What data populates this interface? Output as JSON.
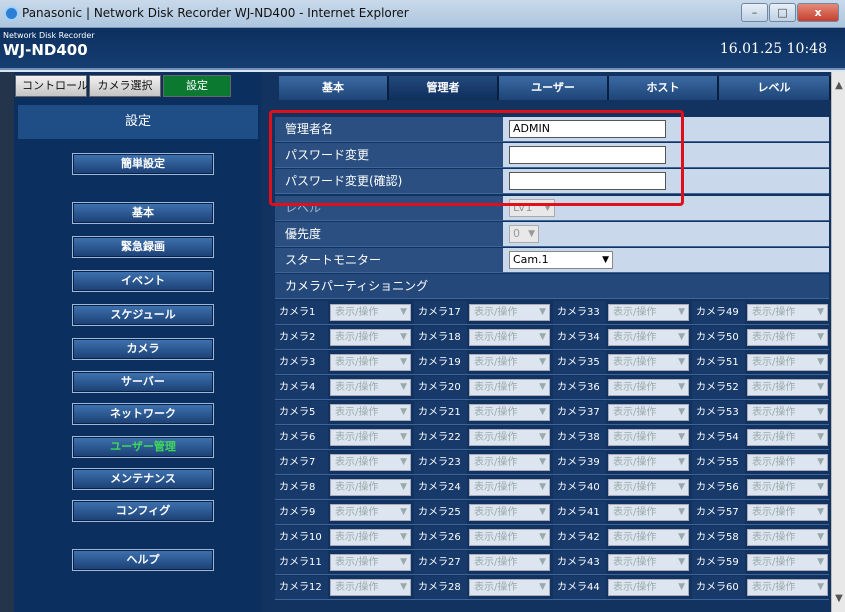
{
  "window": {
    "title": "Panasonic | Network Disk Recorder WJ-ND400 - Internet Explorer",
    "minimize": "–",
    "maximize": "□",
    "close": "x"
  },
  "header": {
    "product": "Network Disk Recorder",
    "model": "WJ-ND400",
    "datetime": "16.01.25  10:48"
  },
  "top_tabs": [
    {
      "label": "コントロール"
    },
    {
      "label": "カメラ選択"
    },
    {
      "label": "設定"
    }
  ],
  "sidebar": {
    "title": "設定",
    "items": [
      {
        "label": "簡単設定"
      },
      {
        "label": "基本"
      },
      {
        "label": "緊急録画"
      },
      {
        "label": "イベント"
      },
      {
        "label": "スケジュール"
      },
      {
        "label": "カメラ"
      },
      {
        "label": "サーバー"
      },
      {
        "label": "ネットワーク"
      },
      {
        "label": "ユーザー管理"
      },
      {
        "label": "メンテナンス"
      },
      {
        "label": "コンフィグ"
      },
      {
        "label": "ヘルプ"
      }
    ]
  },
  "tabs": [
    {
      "label": "基本"
    },
    {
      "label": "管理者"
    },
    {
      "label": "ユーザー"
    },
    {
      "label": "ホスト"
    },
    {
      "label": "レベル"
    }
  ],
  "form": {
    "admin_name_label": "管理者名",
    "admin_name_value": "ADMIN",
    "password_label": "パスワード変更",
    "password_value": "",
    "password_confirm_label": "パスワード変更(確認)",
    "password_confirm_value": "",
    "level_label": "レベル",
    "level_value": "LV1",
    "priority_label": "優先度",
    "priority_value": "0",
    "start_monitor_label": "スタートモニター",
    "start_monitor_value": "Cam.1",
    "partition_label": "カメラパーティショニング"
  },
  "camera_option": "表示/操作",
  "cameras": [
    [
      "カメラ1",
      "カメラ17",
      "カメラ33",
      "カメラ49"
    ],
    [
      "カメラ2",
      "カメラ18",
      "カメラ34",
      "カメラ50"
    ],
    [
      "カメラ3",
      "カメラ19",
      "カメラ35",
      "カメラ51"
    ],
    [
      "カメラ4",
      "カメラ20",
      "カメラ36",
      "カメラ52"
    ],
    [
      "カメラ5",
      "カメラ21",
      "カメラ37",
      "カメラ53"
    ],
    [
      "カメラ6",
      "カメラ22",
      "カメラ38",
      "カメラ54"
    ],
    [
      "カメラ7",
      "カメラ23",
      "カメラ39",
      "カメラ55"
    ],
    [
      "カメラ8",
      "カメラ24",
      "カメラ40",
      "カメラ56"
    ],
    [
      "カメラ9",
      "カメラ25",
      "カメラ41",
      "カメラ57"
    ],
    [
      "カメラ10",
      "カメラ26",
      "カメラ42",
      "カメラ58"
    ],
    [
      "カメラ11",
      "カメラ27",
      "カメラ43",
      "カメラ59"
    ],
    [
      "カメラ12",
      "カメラ28",
      "カメラ44",
      "カメラ60"
    ]
  ]
}
